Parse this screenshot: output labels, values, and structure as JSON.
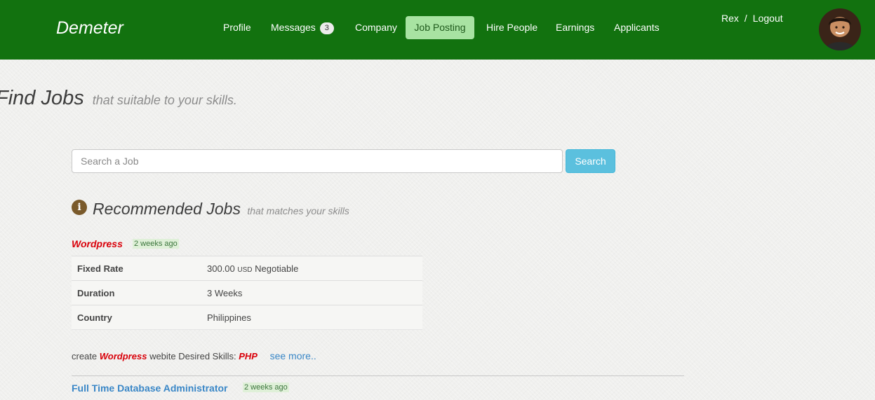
{
  "navbar": {
    "brand": "Demeter",
    "items": [
      {
        "label": "Profile"
      },
      {
        "label": "Messages",
        "badge": "3"
      },
      {
        "label": "Company"
      },
      {
        "label": "Job Posting",
        "active": true
      },
      {
        "label": "Hire People"
      },
      {
        "label": "Earnings"
      },
      {
        "label": "Applicants"
      }
    ],
    "user": {
      "name": "Rex",
      "separator": "/",
      "logout": "Logout"
    },
    "avatar_icon": "user-avatar",
    "color": "#12720f"
  },
  "header": {
    "title": "Find Jobs",
    "subtitle": "that suitable to your skills."
  },
  "search": {
    "placeholder": "Search a Job",
    "value": "",
    "button_label": "Search"
  },
  "recommended": {
    "icon": "info-icon",
    "title": "Recommended Jobs",
    "subtitle": "that matches your skills",
    "jobs": [
      {
        "title": "Wordpress",
        "posted": "2 weeks ago",
        "details": [
          {
            "label": "Fixed Rate",
            "value": "300.00",
            "currency": "USD",
            "note": "Negotiable"
          },
          {
            "label": "Duration",
            "value": "3 Weeks"
          },
          {
            "label": "Country",
            "value": "Philippines"
          }
        ],
        "description": {
          "prefix": "create",
          "highlight": "Wordpress",
          "middle": "webite Desired Skills:",
          "skill": "PHP",
          "more": "see more.."
        }
      },
      {
        "title": "Full Time Database Administrator",
        "posted": "2 weeks ago"
      }
    ]
  }
}
